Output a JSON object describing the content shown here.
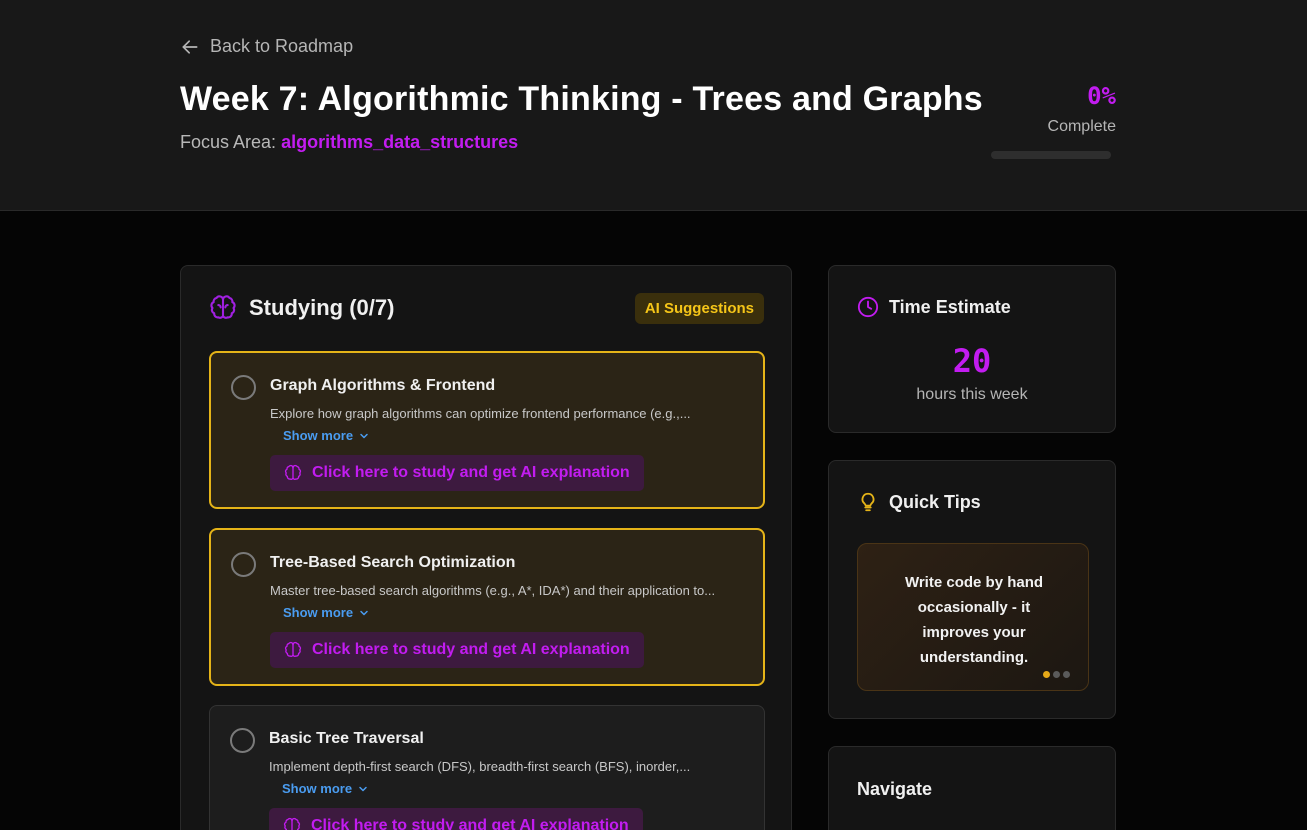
{
  "header": {
    "back_label": "Back to Roadmap",
    "title": "Week 7: Algorithmic Thinking - Trees and Graphs",
    "focus_prefix": "Focus Area:",
    "focus_value": "algorithms_data_structures",
    "progress_percent_text": "0%",
    "progress_fraction": 0,
    "progress_label": "Complete"
  },
  "studying": {
    "title": "Studying (0/7)",
    "badge": "AI Suggestions",
    "tasks": [
      {
        "title": "Graph Algorithms & Frontend",
        "description": "Explore how graph algorithms can optimize frontend performance (e.g.,...",
        "show_more": "Show more",
        "study_button": "Click here to study and get AI explanation",
        "highlighted": true
      },
      {
        "title": "Tree-Based Search Optimization",
        "description": "Master tree-based search algorithms (e.g., A*, IDA*) and their application to...",
        "show_more": "Show more",
        "study_button": "Click here to study and get AI explanation",
        "highlighted": true
      },
      {
        "title": "Basic Tree Traversal",
        "description": "Implement depth-first search (DFS), breadth-first search (BFS), inorder,...",
        "show_more": "Show more",
        "study_button": "Click here to study and get AI explanation",
        "highlighted": false
      }
    ]
  },
  "time_estimate": {
    "title": "Time Estimate",
    "value": "20",
    "label": "hours this week"
  },
  "quick_tips": {
    "title": "Quick Tips",
    "tip": "Write code by hand occasionally - it improves your understanding.",
    "dot_count": 3,
    "active_dot": 0
  },
  "navigate": {
    "title": "Navigate"
  },
  "colors": {
    "accent": "#c21cf0",
    "highlight_border": "#e5b418",
    "link": "#4a9cf0"
  },
  "icons": {
    "back": "arrow-left-icon",
    "studying": "brain-icon",
    "task_check": "circle-icon",
    "show_more": "chevron-down-icon",
    "study_button": "brain-icon",
    "time": "clock-icon",
    "tips": "lightbulb-icon"
  }
}
